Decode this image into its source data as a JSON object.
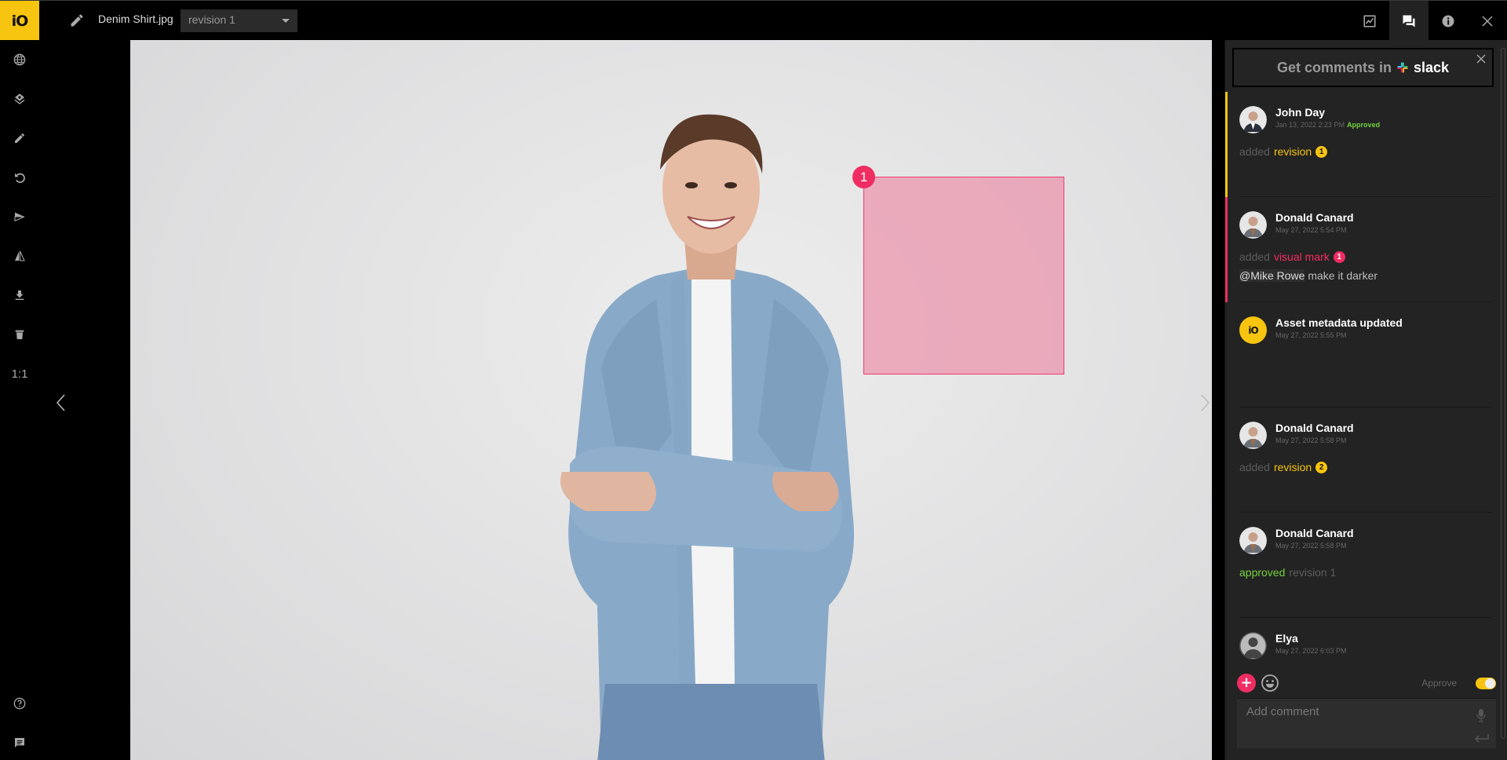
{
  "app": {
    "logo_text": "iO",
    "file_name": "Denim Shirt.jpg",
    "revision_selected": "revision 1"
  },
  "top_right_buttons": [
    {
      "name": "activity-chart",
      "icon": "chart-line-icon",
      "active": false
    },
    {
      "name": "comments",
      "icon": "comments-icon",
      "active": true
    },
    {
      "name": "info",
      "icon": "info-icon",
      "active": false
    },
    {
      "name": "close",
      "icon": "close-icon",
      "active": false
    }
  ],
  "left_tools": [
    {
      "name": "globe",
      "icon": "globe-icon"
    },
    {
      "name": "layers",
      "icon": "layers-add-icon"
    },
    {
      "name": "draw",
      "icon": "pencil-icon"
    },
    {
      "name": "undo",
      "icon": "undo-icon"
    },
    {
      "name": "send",
      "icon": "send-icon"
    },
    {
      "name": "flip",
      "icon": "flip-icon"
    },
    {
      "name": "download",
      "icon": "download-icon"
    },
    {
      "name": "delete",
      "icon": "trash-icon"
    },
    {
      "name": "actual-size",
      "label": "1:1"
    }
  ],
  "left_bottom_tools": [
    {
      "name": "help",
      "icon": "help-icon"
    },
    {
      "name": "chat",
      "icon": "chat-icon"
    }
  ],
  "canvas": {
    "visual_mark_number": "1"
  },
  "slack_banner": {
    "text": "Get comments in",
    "brand": "slack"
  },
  "feed": [
    {
      "name": "John Day",
      "time": "Jan 13, 2022 2:23 PM",
      "status": "Approved",
      "accent": "#f7c40f",
      "action_prefix": "added",
      "action_target": "revision",
      "badge": "1",
      "badge_color": "yellow"
    },
    {
      "name": "Donald Canard",
      "time": "May 27, 2022 5:54 PM",
      "accent": "#ef2d62",
      "action_prefix": "added",
      "action_target": "visual mark",
      "badge": "1",
      "badge_color": "pink",
      "mention": "@Mike Rowe",
      "comment": "make it darker"
    },
    {
      "name": "Asset metadata updated",
      "time": "May 27, 2022 5:55 PM"
    },
    {
      "name": "Donald Canard",
      "time": "May 27, 2022 5:58 PM",
      "action_prefix": "added",
      "action_target": "revision",
      "badge": "2",
      "badge_color": "yellow"
    },
    {
      "name": "Donald Canard",
      "time": "May 27, 2022 5:58 PM",
      "action_verb": "approved",
      "action_rest": "revision 1"
    },
    {
      "name": "Elya",
      "time": "May 27, 2022 6:03 PM"
    }
  ],
  "composer": {
    "approve_label": "Approve",
    "approve_on": true,
    "placeholder": "Add comment"
  },
  "colors": {
    "brand_yellow": "#f7c40f",
    "mark_pink": "#ef2d62",
    "approved_green": "#73d13d"
  }
}
